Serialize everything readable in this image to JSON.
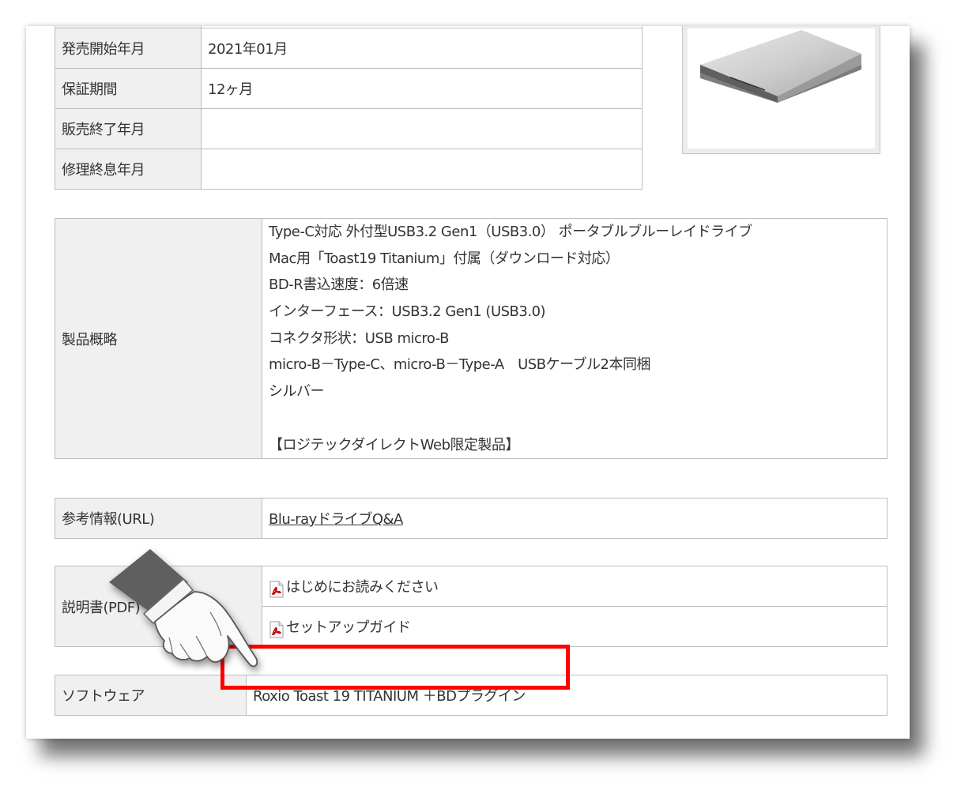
{
  "spec_table": {
    "rows": [
      {
        "label": "発売開始年月",
        "value": "2021年01月"
      },
      {
        "label": "保証期間",
        "value": "12ヶ月"
      },
      {
        "label": "販売終了年月",
        "value": ""
      },
      {
        "label": "修理終息年月",
        "value": ""
      }
    ]
  },
  "summary": {
    "label": "製品概略",
    "lines": [
      "Type-C対応 外付型USB3.2 Gen1（USB3.0） ポータブルブルーレイドライブ",
      "Mac用「Toast19 Titanium」付属（ダウンロード対応）",
      "BD-R書込速度：6倍速",
      "インターフェース：USB3.2 Gen1 (USB3.0)",
      "コネクタ形状：USB micro-B",
      "micro-B－Type-C、micro-B－Type-A　USBケーブル2本同梱",
      "シルバー",
      "",
      "【ロジテックダイレクトWeb限定製品】"
    ]
  },
  "reference": {
    "label": "参考情報(URL)",
    "link_text": "Blu-rayドライブQ&A"
  },
  "manuals": {
    "label": "説明書(PDF)",
    "items": [
      "はじめにお読みください",
      "セットアップガイド"
    ]
  },
  "software": {
    "label": "ソフトウェア",
    "value": "Roxio Toast 19 TITANIUM ＋BDプラグイン"
  },
  "icons": {
    "pdf": "pdf-icon",
    "hand": "pointing-hand-icon"
  },
  "colors": {
    "highlight": "#ff0000",
    "header_bg": "#f0f0f0",
    "border": "#bdbdbd"
  }
}
